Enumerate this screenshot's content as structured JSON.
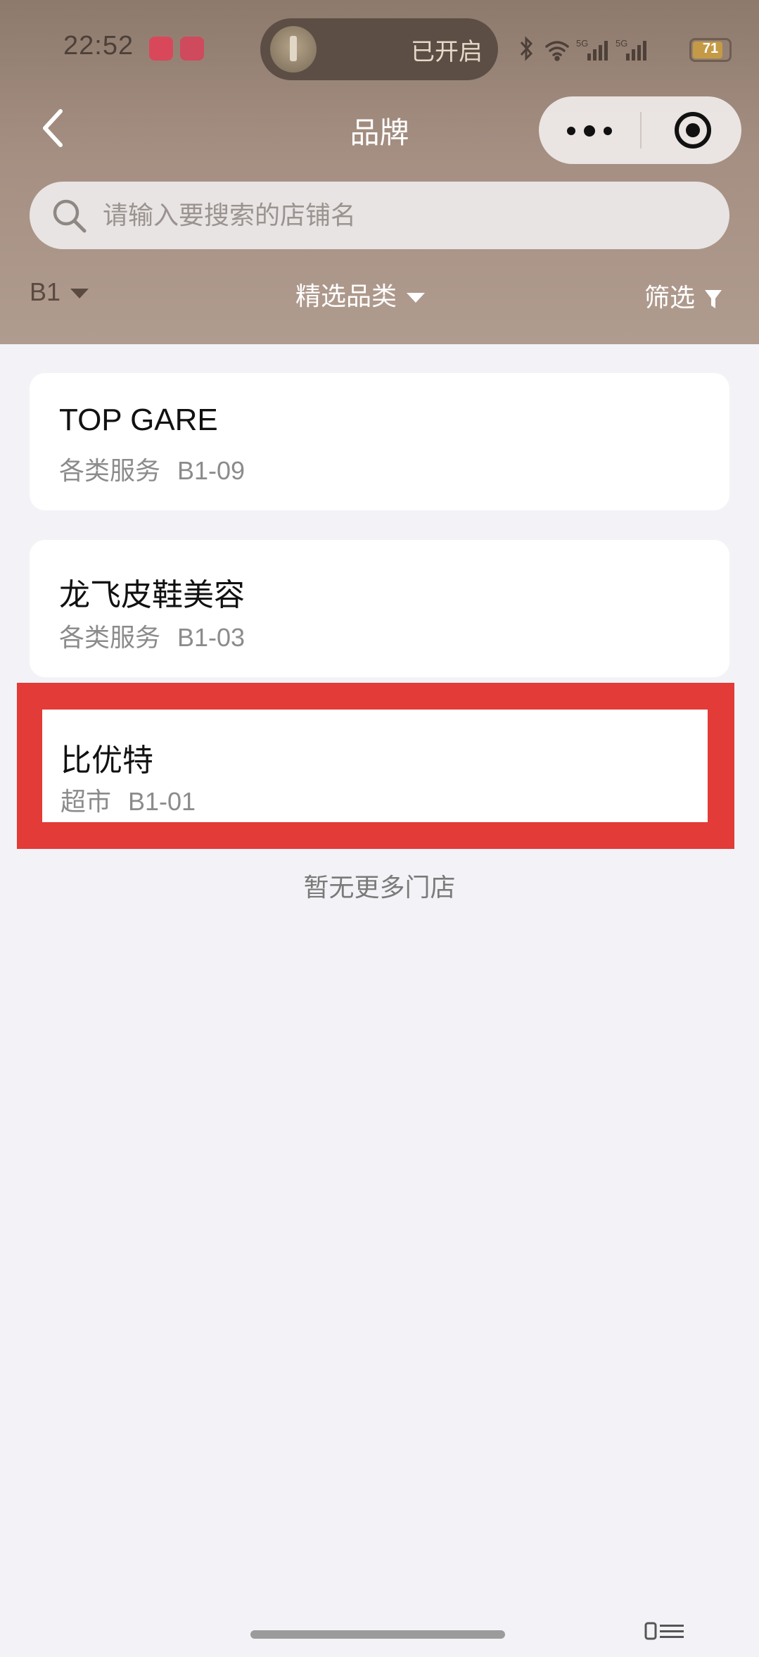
{
  "status_bar": {
    "time": "22:52",
    "flashlight_status": "已开启",
    "battery_level": "71",
    "network_1": "5G",
    "network_2": "5G",
    "icons": [
      "bluetooth-icon",
      "wifi-icon",
      "signal-icon",
      "battery-icon",
      "flashlight-icon"
    ]
  },
  "nav": {
    "title": "品牌",
    "back_icon": "chevron-left-icon",
    "more_icon": "more-dots-icon",
    "close_icon": "target-circle-icon"
  },
  "search": {
    "placeholder": "请输入要搜索的店铺名",
    "value": ""
  },
  "filters": {
    "floor": "B1",
    "category": "精选品类",
    "screen": "筛选"
  },
  "stores": [
    {
      "name": "TOP GARE",
      "category": "各类服务",
      "code": "B1-09"
    },
    {
      "name": "龙飞皮鞋美容",
      "category": "各类服务",
      "code": "B1-03"
    },
    {
      "name": "比优特",
      "category": "超市",
      "code": "B1-01",
      "highlighted": true
    }
  ],
  "list_footer": "暂无更多门店",
  "colors": {
    "header_top": "#8d7a6c",
    "header_bottom": "#b09c8f",
    "background": "#f3f3f7",
    "highlight": "#e23b38",
    "battery": "#c59a46"
  }
}
